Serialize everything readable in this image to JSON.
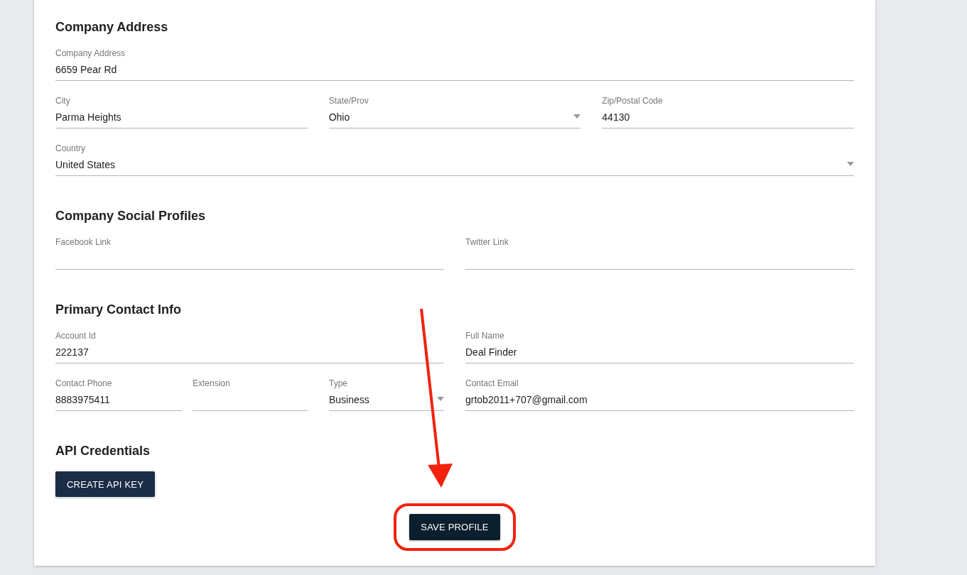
{
  "sections": [
    {
      "title": "Company Address",
      "rows": [
        {
          "kind": "full",
          "fields": [
            {
              "kind": "text",
              "label": "Company Address",
              "value": "6659 Pear Rd"
            }
          ]
        },
        {
          "kind": "thirds",
          "fields": [
            {
              "kind": "text",
              "label": "City",
              "value": "Parma Heights"
            },
            {
              "kind": "select",
              "label": "State/Prov",
              "value": "Ohio"
            },
            {
              "kind": "text",
              "label": "Zip/Postal Code",
              "value": "44130"
            }
          ]
        },
        {
          "kind": "full",
          "fields": [
            {
              "kind": "select",
              "label": "Country",
              "value": "United States"
            }
          ]
        }
      ]
    },
    {
      "title": "Company Social Profiles",
      "rows": [
        {
          "kind": "halves",
          "fields": [
            {
              "kind": "text",
              "label": "Facebook Link"
            },
            {
              "kind": "text",
              "label": "Twitter Link"
            }
          ]
        }
      ]
    },
    {
      "title": "Primary Contact Info",
      "rows": [
        {
          "kind": "halves",
          "fields": [
            {
              "kind": "text",
              "label": "Account Id",
              "value": "222137"
            },
            {
              "kind": "text",
              "label": "Full Name",
              "value": "Deal Finder"
            }
          ]
        },
        {
          "kind": "contact",
          "fields": [
            {
              "kind": "text",
              "label": "Contact Phone",
              "value": "8883975411"
            },
            {
              "kind": "text",
              "label": "Extension"
            },
            {
              "kind": "select",
              "label": "Type",
              "value": "Business"
            },
            {
              "kind": "text",
              "label": "Contact Email",
              "value": "grtob2011+707@gmail.com"
            }
          ]
        }
      ]
    },
    {
      "title": "API Credentials",
      "button": "CREATE API KEY"
    }
  ],
  "save_button": "SAVE PROFILE"
}
